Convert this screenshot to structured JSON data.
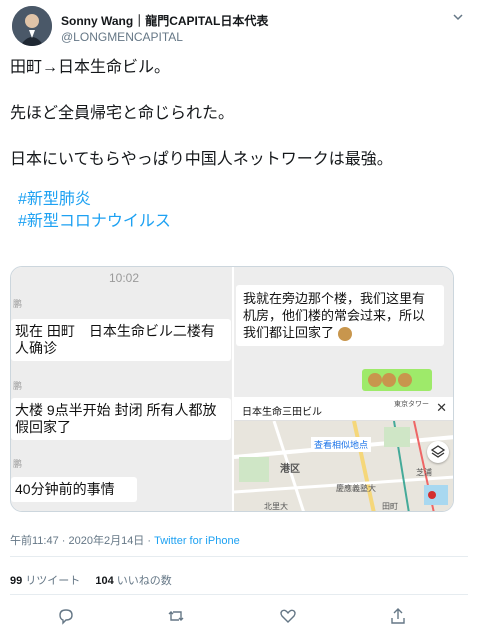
{
  "user": {
    "name": "Sonny Wang｜龍門CAPITAL日本代表",
    "handle": "@LONGMENCAPITAL",
    "avatar_icon": "profile-photo"
  },
  "tweet": {
    "line1": "田町→日本生命ビル。",
    "line2": "先ほど全員帰宅と命じられた。",
    "line3": "日本にいてもらやっぱり中国人ネットワークは最強。",
    "hashtag1": "#新型肺炎",
    "hashtag2": "#新型コロナウイルス"
  },
  "media": {
    "left": {
      "time": "10:02",
      "sender": "鹏",
      "msg1": "现在 田町　日本生命ビル二楼有人确诊",
      "msg2": "大楼 9点半开始 封闭 所有人都放假回家了",
      "msg3": "40分钟前的事情"
    },
    "right": {
      "msg": "我就在旁边那个楼，我们这里有机房，他们楼的常会过来，所以我们都让回家了",
      "map_title": "日本生命三田ビル",
      "map_close": "✕",
      "map_link": "查看相似地点",
      "map_labels": [
        "港区",
        "慶應義塾大",
        "北里大",
        "田町",
        "芝浦",
        "東京タワー"
      ]
    }
  },
  "meta": {
    "time": "午前11:47 · 2020年2月14日 · ",
    "source": "Twitter for iPhone"
  },
  "stats": {
    "retweets_count": "99",
    "retweets_label": "リツイート",
    "likes_count": "104",
    "likes_label": "いいねの数"
  },
  "actions": [
    "reply-icon",
    "retweet-icon",
    "like-icon",
    "share-icon"
  ],
  "colors": {
    "link": "#1da1f2",
    "text": "#14171a",
    "muted": "#657786",
    "wechat_green": "#9eea6a"
  }
}
